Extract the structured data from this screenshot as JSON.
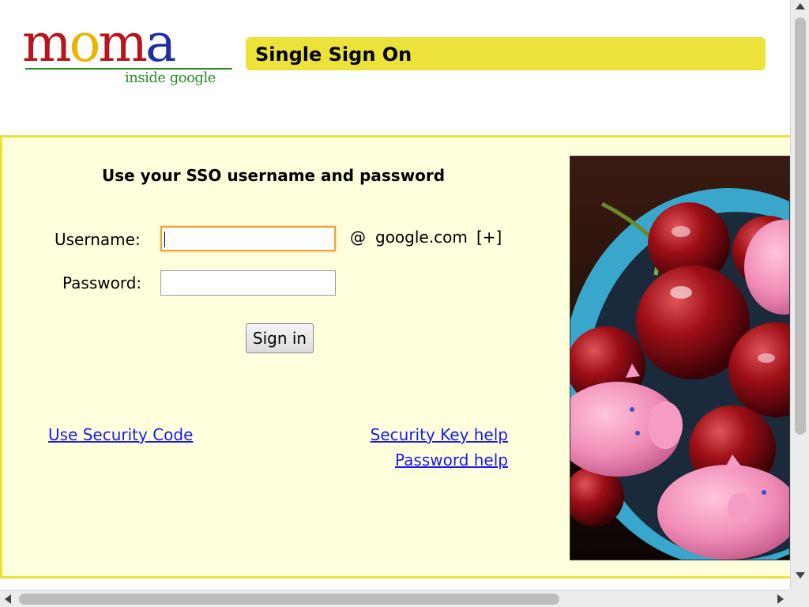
{
  "logo": {
    "letters": [
      {
        "char": "m",
        "color": "#b8141a"
      },
      {
        "char": "o",
        "color": "#e8b400"
      },
      {
        "char": "m",
        "color": "#b8141a"
      },
      {
        "char": "a",
        "color": "#1f2fa0"
      }
    ],
    "tagline": "inside google",
    "tagline_color": "#2c8a2c"
  },
  "header": {
    "title": "Single Sign On",
    "bar_color": "#ece23a"
  },
  "form": {
    "heading": "Use your SSO username and password",
    "username_label": "Username:",
    "username_value": "",
    "at_symbol": "@",
    "domain": "google.com",
    "domain_more": "[+]",
    "password_label": "Password:",
    "password_value": "",
    "signin_label": "Sign in"
  },
  "links": {
    "security_code": "Use Security Code",
    "security_key_help": "Security Key help",
    "password_help": "Password help",
    "color": "#1a1aee"
  },
  "photo": {
    "icon": "cherries-and-pig-figurines-photo"
  },
  "colors": {
    "panel_bg": "#ffffdd",
    "panel_border": "#ece23a"
  }
}
